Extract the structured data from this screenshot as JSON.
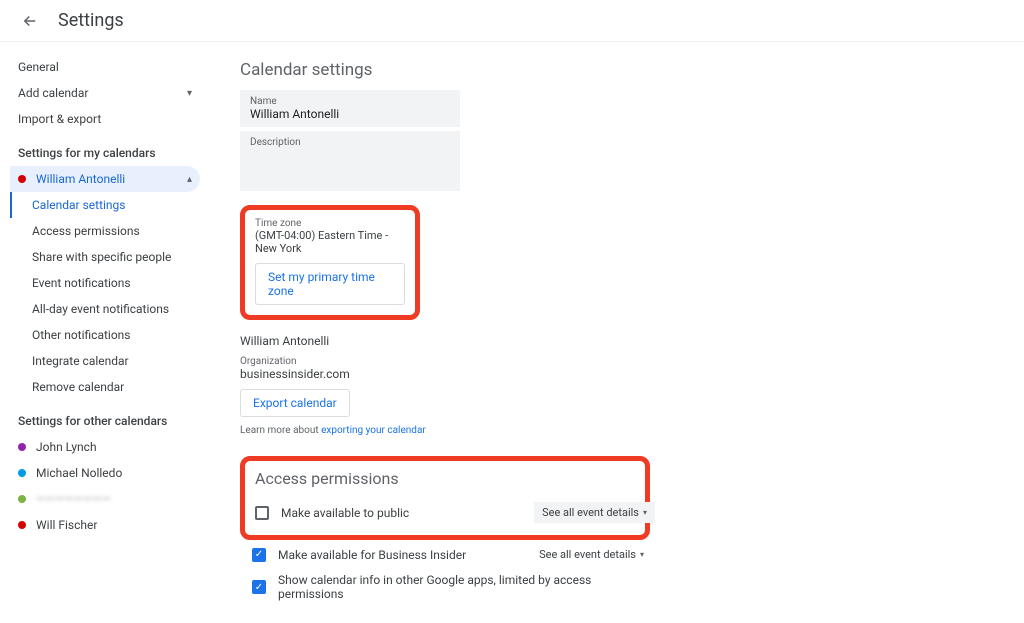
{
  "header": {
    "title": "Settings"
  },
  "sidebar": {
    "general": "General",
    "add_calendar": "Add calendar",
    "import_export": "Import & export",
    "my_calendars_title": "Settings for my calendars",
    "selected_calendar": "William Antonelli",
    "subitems": [
      "Calendar settings",
      "Access permissions",
      "Share with specific people",
      "Event notifications",
      "All-day event notifications",
      "Other notifications",
      "Integrate calendar",
      "Remove calendar"
    ],
    "other_calendars_title": "Settings for other calendars",
    "other_calendars": [
      {
        "name": "John Lynch",
        "color": "#8e24aa"
      },
      {
        "name": "Michael Nolledo",
        "color": "#039be5"
      },
      {
        "name": "————————",
        "color": "#7cb342",
        "blurred": true
      },
      {
        "name": "Will Fischer",
        "color": "#d50000"
      }
    ]
  },
  "main": {
    "section_title": "Calendar settings",
    "name_label": "Name",
    "name_value": "William Antonelli",
    "description_label": "Description",
    "tz_label": "Time zone",
    "tz_value": "(GMT-04:00) Eastern Time - New York",
    "tz_button": "Set my primary time zone",
    "owner": "William Antonelli",
    "org_label": "Organization",
    "org_value": "businessinsider.com",
    "export_button": "Export calendar",
    "learn_more_prefix": "Learn more about ",
    "learn_more_link": "exporting your calendar",
    "access_title": "Access permissions",
    "perms": [
      {
        "label": "Make available to public",
        "checked": false,
        "dropdown": "See all event details",
        "dropdown_style": "pill"
      },
      {
        "label": "Make available for Business Insider",
        "checked": true,
        "dropdown": "See all event details",
        "dropdown_style": "plain"
      },
      {
        "label": "Show calendar info in other Google apps, limited by access permissions",
        "checked": true
      }
    ]
  }
}
